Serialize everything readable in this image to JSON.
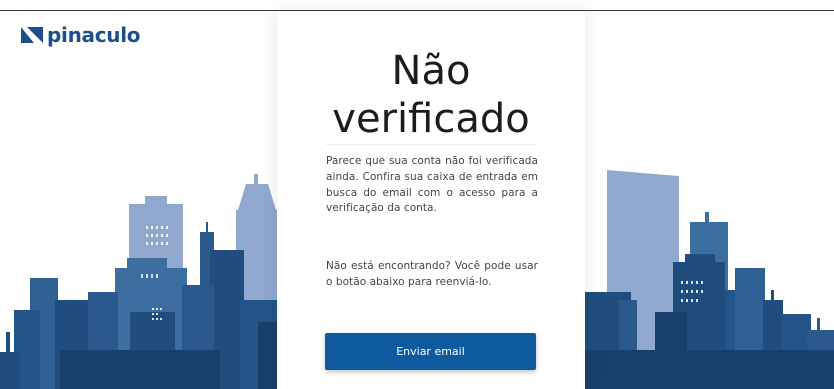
{
  "brand": {
    "name": "pinaculo",
    "color": "#1d4f8f"
  },
  "card": {
    "title_line1": "Não",
    "title_line2": "verificado",
    "message": "Parece que sua conta não foi verificada ainda. Confira sua caixa de entrada em busca do email com o acesso para a verificação da conta.",
    "hint": "Não está encontrando? Você pode usar o botão abaixo para reenviá-lo.",
    "button_label": "Enviar email"
  },
  "colors": {
    "accent": "#0d5a9e",
    "building_dark": "#1e4d7e",
    "building_mid": "#3c6ea0",
    "building_light": "#92a9cf"
  }
}
